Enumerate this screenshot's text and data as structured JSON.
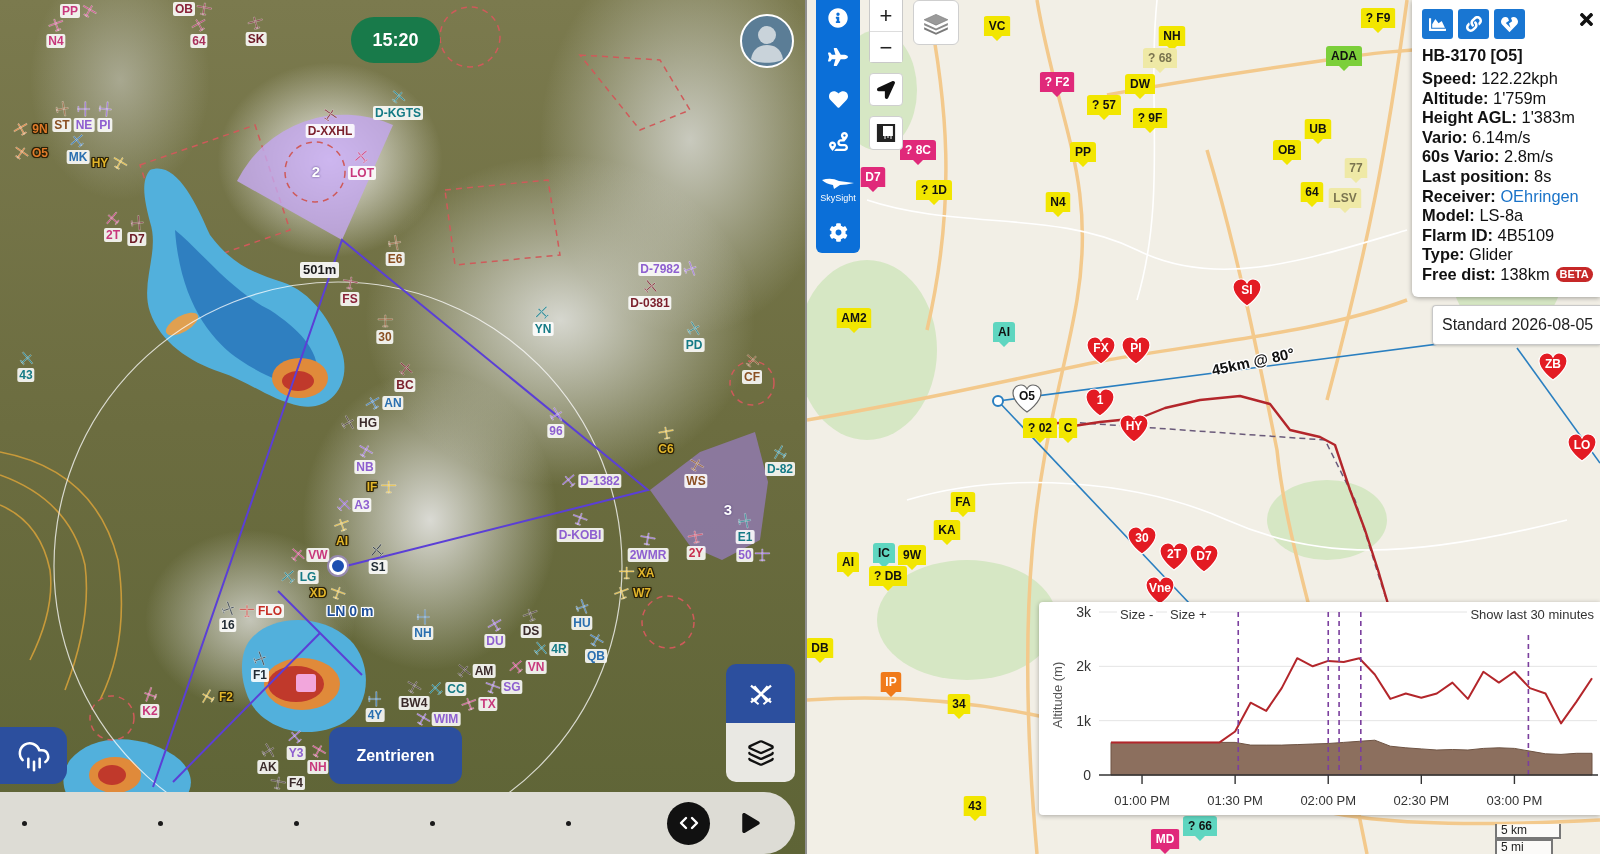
{
  "left_map": {
    "clock": "15:20",
    "ring_label": "501m",
    "sector_numbers": [
      "2",
      "3"
    ],
    "own_position": "LN 0 m",
    "gliders": [
      {
        "label": "PP",
        "color": "#c8387c"
      },
      {
        "label": "N4",
        "color": "#c8387c"
      },
      {
        "label": "OB",
        "color": "#8a2238"
      },
      {
        "label": "64",
        "color": "#a8305a"
      },
      {
        "label": "SK",
        "color": "#6e1a26"
      },
      {
        "label": "D-KGTS",
        "color": "#147a85"
      },
      {
        "label": "D-XXHL",
        "color": "#7a1f2b"
      },
      {
        "label": "LOT",
        "color": "#c8387c"
      },
      {
        "label": "E6",
        "color": "#8a4f22"
      },
      {
        "label": "FS",
        "color": "#8a2238"
      },
      {
        "label": "30",
        "color": "#8a4f22"
      },
      {
        "label": "BC",
        "color": "#7a1f2b"
      },
      {
        "label": "AN",
        "color": "#2a6fb0"
      },
      {
        "label": "HG",
        "color": "#3a2a2a"
      },
      {
        "label": "YN",
        "color": "#147a85"
      },
      {
        "label": "D-7982",
        "color": "#8e5fd0"
      },
      {
        "label": "D-0381",
        "color": "#7a1f2b"
      },
      {
        "label": "PD",
        "color": "#147a85"
      },
      {
        "label": "CF",
        "color": "#8a4f22"
      },
      {
        "label": "ST",
        "color": "#8a4f22"
      },
      {
        "label": "NE",
        "color": "#8e5fd0"
      },
      {
        "label": "PI",
        "color": "#8e5fd0"
      },
      {
        "label": "9N",
        "color": "#e07a2a"
      },
      {
        "label": "O5",
        "color": "#e07a2a"
      },
      {
        "label": "MK",
        "color": "#2a6fb0"
      },
      {
        "label": "HY",
        "color": "#e3b62a"
      },
      {
        "label": "2T",
        "color": "#c8387c"
      },
      {
        "label": "D7",
        "color": "#6e1a26"
      },
      {
        "label": "43",
        "color": "#147a85"
      },
      {
        "label": "96",
        "color": "#8e5fd0"
      },
      {
        "label": "C6",
        "color": "#e3b62a"
      },
      {
        "label": "WS",
        "color": "#8a4f22"
      },
      {
        "label": "D-82",
        "color": "#147a85"
      },
      {
        "label": "D-1382",
        "color": "#8e5fd0"
      },
      {
        "label": "D-KOBI",
        "color": "#8e5fd0"
      },
      {
        "label": "2WMR",
        "color": "#8e5fd0"
      },
      {
        "label": "XA",
        "color": "#e3b62a"
      },
      {
        "label": "W7",
        "color": "#e3b62a"
      },
      {
        "label": "2Y",
        "color": "#c8304f"
      },
      {
        "label": "E1",
        "color": "#147a85"
      },
      {
        "label": "50",
        "color": "#8e5fd0"
      },
      {
        "label": "NB",
        "color": "#8e5fd0"
      },
      {
        "label": "IF",
        "color": "#e3b62a"
      },
      {
        "label": "A3",
        "color": "#8e5fd0"
      },
      {
        "label": "AI",
        "color": "#e3b62a"
      },
      {
        "label": "VW",
        "color": "#c8387c"
      },
      {
        "label": "S1",
        "color": "#1f2a33"
      },
      {
        "label": "LG",
        "color": "#147a85"
      },
      {
        "label": "XD",
        "color": "#e3b62a"
      },
      {
        "label": "FLO",
        "color": "#c62d25"
      },
      {
        "label": "16",
        "color": "#1f2a33"
      },
      {
        "label": "F1",
        "color": "#1f2a33"
      },
      {
        "label": "F2",
        "color": "#e3b62a"
      },
      {
        "label": "K2",
        "color": "#c8387c"
      },
      {
        "label": "NH",
        "color": "#2a6fb0"
      },
      {
        "label": "DS",
        "color": "#3a2a2a"
      },
      {
        "label": "HU",
        "color": "#2a6fb0"
      },
      {
        "label": "DU",
        "color": "#8e5fd0"
      },
      {
        "label": "4R",
        "color": "#147a85"
      },
      {
        "label": "QB",
        "color": "#2a6fb0"
      },
      {
        "label": "VN",
        "color": "#c8387c"
      },
      {
        "label": "AM",
        "color": "#3a2a2a"
      },
      {
        "label": "SG",
        "color": "#8e5fd0"
      },
      {
        "label": "CC",
        "color": "#147a85"
      },
      {
        "label": "TX",
        "color": "#c8387c"
      },
      {
        "label": "BW4",
        "color": "#3a2a2a"
      },
      {
        "label": "WIM",
        "color": "#8e5fd0"
      },
      {
        "label": "4Y",
        "color": "#2a6fb0"
      },
      {
        "label": "Y3",
        "color": "#8e5fd0"
      },
      {
        "label": "NH",
        "color": "#c8387c"
      },
      {
        "label": "AK",
        "color": "#3a2a2a"
      },
      {
        "label": "F4",
        "color": "#3a2a2a"
      }
    ],
    "center_button": "Zentrieren",
    "side_buttons": [
      {
        "kind": "gliders",
        "on": true
      },
      {
        "kind": "layers",
        "on": false
      }
    ]
  },
  "right_map": {
    "toolbar": [
      {
        "kind": "info"
      },
      {
        "kind": "aircraft"
      },
      {
        "kind": "favorites"
      },
      {
        "kind": "route"
      },
      {
        "kind": "skysight",
        "label": "SkySight"
      },
      {
        "kind": "settings"
      }
    ],
    "zoom": [
      "+",
      "−"
    ],
    "markers": [
      {
        "kind": "tag",
        "label": "VC",
        "color": "#f2e600",
        "stale": false
      },
      {
        "kind": "tag",
        "label": "NH",
        "color": "#f2e600",
        "stale": false
      },
      {
        "kind": "tag",
        "label": "? F9",
        "color": "#f2e600",
        "stale": false
      },
      {
        "kind": "tag",
        "label": "? 68",
        "color": "#efe9a6",
        "stale": true
      },
      {
        "kind": "tag",
        "label": "ADA",
        "color": "#7ccf3a",
        "stale": false
      },
      {
        "kind": "tag",
        "label": "? F2",
        "color": "#e0297a",
        "stale": false
      },
      {
        "kind": "tag",
        "label": "DW",
        "color": "#f2e600",
        "stale": false
      },
      {
        "kind": "tag",
        "label": "? 57",
        "color": "#f2e600",
        "stale": false
      },
      {
        "kind": "tag",
        "label": "? 9F",
        "color": "#f2e600",
        "stale": false
      },
      {
        "kind": "tag",
        "label": "UB",
        "color": "#f2e600",
        "stale": false
      },
      {
        "kind": "tag",
        "label": "? 8C",
        "color": "#e0297a",
        "stale": false
      },
      {
        "kind": "tag",
        "label": "PP",
        "color": "#f2e600",
        "stale": false
      },
      {
        "kind": "tag",
        "label": "OB",
        "color": "#f2e600",
        "stale": false
      },
      {
        "kind": "tag",
        "label": "D7",
        "color": "#e0297a",
        "stale": false
      },
      {
        "kind": "tag",
        "label": "77",
        "color": "#efe9a6",
        "stale": true
      },
      {
        "kind": "tag",
        "label": "? 1D",
        "color": "#f2e600",
        "stale": false
      },
      {
        "kind": "tag",
        "label": "N4",
        "color": "#f2e600",
        "stale": false
      },
      {
        "kind": "tag",
        "label": "64",
        "color": "#f2e600",
        "stale": false
      },
      {
        "kind": "tag",
        "label": "LSV",
        "color": "#efe9a6",
        "stale": true
      },
      {
        "kind": "heart",
        "label": "SI",
        "color": "#e31b23",
        "stale": false
      },
      {
        "kind": "tag",
        "label": "AM2",
        "color": "#f2e600",
        "stale": false
      },
      {
        "kind": "tag",
        "label": "AI",
        "color": "#5fd6c0",
        "stale": false
      },
      {
        "kind": "heart",
        "label": "FX",
        "color": "#e31b23",
        "stale": false
      },
      {
        "kind": "heart",
        "label": "PI",
        "color": "#e31b23",
        "stale": false
      },
      {
        "kind": "heart",
        "label": "ZB",
        "color": "#e31b23",
        "stale": false
      },
      {
        "kind": "heart",
        "label": "O5",
        "color": "#ffffff",
        "stale": false
      },
      {
        "kind": "heart",
        "label": "1",
        "color": "#e31b23",
        "stale": false
      },
      {
        "kind": "tag",
        "label": "? 02",
        "color": "#f2e600",
        "stale": false
      },
      {
        "kind": "tag",
        "label": "C",
        "color": "#f2e600",
        "stale": false
      },
      {
        "kind": "heart",
        "label": "HY",
        "color": "#e31b23",
        "stale": false
      },
      {
        "kind": "heart",
        "label": "LO",
        "color": "#e31b23",
        "stale": false
      },
      {
        "kind": "tag",
        "label": "FA",
        "color": "#f2e600",
        "stale": false
      },
      {
        "kind": "tag",
        "label": "KA",
        "color": "#f2e600",
        "stale": false
      },
      {
        "kind": "tag",
        "label": "AI",
        "color": "#f2e600",
        "stale": false
      },
      {
        "kind": "tag",
        "label": "IC",
        "color": "#5fd6c0",
        "stale": false
      },
      {
        "kind": "tag",
        "label": "9W",
        "color": "#f2e600",
        "stale": false
      },
      {
        "kind": "heart",
        "label": "30",
        "color": "#e31b23",
        "stale": false
      },
      {
        "kind": "tag",
        "label": "? DB",
        "color": "#f2e600",
        "stale": false
      },
      {
        "kind": "heart",
        "label": "2T",
        "color": "#e31b23",
        "stale": false
      },
      {
        "kind": "heart",
        "label": "D7",
        "color": "#e31b23",
        "stale": false
      },
      {
        "kind": "heart",
        "label": "Vne",
        "color": "#e31b23",
        "stale": false
      },
      {
        "kind": "tag",
        "label": "DB",
        "color": "#f2e600",
        "stale": false
      },
      {
        "kind": "tag",
        "label": "IP",
        "color": "#f07a1a",
        "stale": false
      },
      {
        "kind": "tag",
        "label": "34",
        "color": "#f2e600",
        "stale": false
      },
      {
        "kind": "tag",
        "label": "43",
        "color": "#f2e600",
        "stale": false
      },
      {
        "kind": "tag",
        "label": "MD",
        "color": "#e0297a",
        "stale": false
      },
      {
        "kind": "tag",
        "label": "? 66",
        "color": "#5fd6c0",
        "stale": false
      }
    ],
    "distance_label": "45km @ 80°",
    "info_panel": {
      "buttons": [
        {
          "kind": "chart"
        },
        {
          "kind": "link"
        },
        {
          "kind": "unfollow"
        }
      ],
      "title": "HB-3170 [O5]",
      "fields": [
        {
          "kind": "text",
          "label": "Speed:",
          "value": "122.22kph"
        },
        {
          "kind": "text",
          "label": "Altitude:",
          "value": "1'759m"
        },
        {
          "kind": "text",
          "label": "Height AGL:",
          "value": "1'383m"
        },
        {
          "kind": "text",
          "label": "Vario:",
          "value": "6.14m/s"
        },
        {
          "kind": "text",
          "label": "60s Vario:",
          "value": "2.8m/s"
        },
        {
          "kind": "text",
          "label": "Last position:",
          "value": "8s"
        },
        {
          "kind": "link",
          "label": "Receiver:",
          "value": "OEhringen"
        },
        {
          "kind": "text",
          "label": "Model:",
          "value": "LS-8a"
        },
        {
          "kind": "text",
          "label": "Flarm ID:",
          "value": "4B5109"
        },
        {
          "kind": "text",
          "label": "Type:",
          "value": "Glider"
        },
        {
          "kind": "badge",
          "label": "Free dist:",
          "value": "138km",
          "badge": "BETA"
        }
      ]
    },
    "tooltip": "Standard 2026-08-05",
    "altitude_chart": {
      "buttons": [
        "Size -",
        "Size +"
      ],
      "range_button": "Show last 30 minutes",
      "chart_data": {
        "type": "line",
        "ylabel": "Altitude (m)",
        "grid": true,
        "categories": [
          null,
          null,
          "01:00 PM",
          null,
          null,
          null,
          null,
          null,
          "01:30 PM",
          null,
          null,
          null,
          null,
          null,
          "02:00 PM",
          null,
          null,
          null,
          null,
          null,
          "02:30 PM",
          null,
          null,
          null,
          null,
          null,
          "03:00 PM",
          null,
          null,
          null,
          null,
          null
        ],
        "series": [
          {
            "type": "line",
            "color": "#b3262b",
            "values": [
              600,
              600,
              600,
              600,
              600,
              600,
              600,
              600,
              800,
              1330,
              1180,
              1600,
              2150,
              2000,
              2100,
              2080,
              2150,
              1850,
              1400,
              1500,
              1420,
              1500,
              1700,
              1400,
              1900,
              1700,
              1900,
              1600,
              1500,
              950,
              1350,
              1780
            ]
          },
          {
            "type": "area",
            "color": "#8c6f5e",
            "values": [
              600,
              600,
              600,
              600,
              600,
              600,
              600,
              600,
              600,
              550,
              550,
              550,
              560,
              570,
              580,
              600,
              620,
              640,
              530,
              500,
              480,
              460,
              470,
              460,
              490,
              500,
              490,
              440,
              390,
              380,
              400,
              400
            ]
          }
        ],
        "ylim": [
          0,
          3000
        ],
        "yticks": [
          {
            "value": 0,
            "label": "0"
          },
          {
            "value": 1000,
            "label": "1k"
          },
          {
            "value": 2000,
            "label": "2k"
          },
          {
            "value": 3000,
            "label": "3k"
          }
        ]
      }
    },
    "scale": [
      "5 km",
      "5 mi"
    ]
  }
}
